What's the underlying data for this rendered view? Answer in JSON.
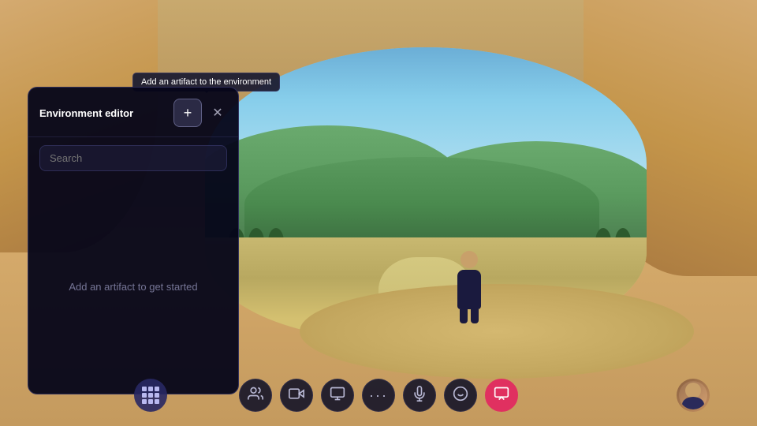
{
  "scene": {
    "bg_color": "#c8a96e"
  },
  "tooltip": {
    "text": "Add an artifact to the environment"
  },
  "env_panel": {
    "title": "Environment editor",
    "search_placeholder": "Search",
    "empty_state": "Add an artifact to get started",
    "add_button_label": "+",
    "close_button_label": "✕"
  },
  "toolbar": {
    "buttons": [
      {
        "id": "people",
        "icon": "👥",
        "label": "People"
      },
      {
        "id": "camera",
        "icon": "📷",
        "label": "Camera"
      },
      {
        "id": "screen",
        "icon": "🖥",
        "label": "Screen"
      },
      {
        "id": "more",
        "icon": "•••",
        "label": "More"
      },
      {
        "id": "mic",
        "icon": "🎤",
        "label": "Microphone"
      },
      {
        "id": "emoji",
        "icon": "🙂",
        "label": "Emoji"
      },
      {
        "id": "share",
        "icon": "📤",
        "label": "Share",
        "active": true
      }
    ],
    "apps_icon": "⊞",
    "avatar_button_label": "Avatar"
  }
}
